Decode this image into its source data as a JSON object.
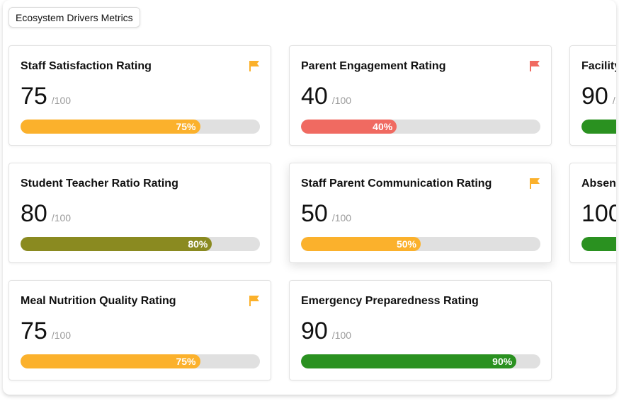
{
  "header": {
    "title": "Ecosystem Drivers Metrics"
  },
  "denominator": "/100",
  "cards": [
    {
      "title": "Staff Satisfaction Rating",
      "score": "75",
      "percent": 75,
      "percent_label": "75%",
      "bar_color": "#FBB12C",
      "flag": "orange"
    },
    {
      "title": "Parent Engagement Rating",
      "score": "40",
      "percent": 40,
      "percent_label": "40%",
      "bar_color": "#F06A61",
      "flag": "red"
    },
    {
      "title": "Facility",
      "score": "90",
      "percent": 90,
      "percent_label": "",
      "bar_color": "#2A9120",
      "flag": "none"
    },
    {
      "title": "Student Teacher Ratio Rating",
      "score": "80",
      "percent": 80,
      "percent_label": "80%",
      "bar_color": "#8A8A20",
      "flag": "none"
    },
    {
      "title": "Staff Parent Communication Rating",
      "score": "50",
      "percent": 50,
      "percent_label": "50%",
      "bar_color": "#FBB12C",
      "flag": "orange"
    },
    {
      "title": "Absen",
      "score": "100",
      "percent": 100,
      "percent_label": "",
      "bar_color": "#2A9120",
      "flag": "none"
    },
    {
      "title": "Meal Nutrition Quality Rating",
      "score": "75",
      "percent": 75,
      "percent_label": "75%",
      "bar_color": "#FBB12C",
      "flag": "orange"
    },
    {
      "title": "Emergency Preparedness Rating",
      "score": "90",
      "percent": 90,
      "percent_label": "90%",
      "bar_color": "#2A9120",
      "flag": "none"
    }
  ],
  "flag_colors": {
    "orange": "#FBB12C",
    "red": "#F06A61"
  }
}
